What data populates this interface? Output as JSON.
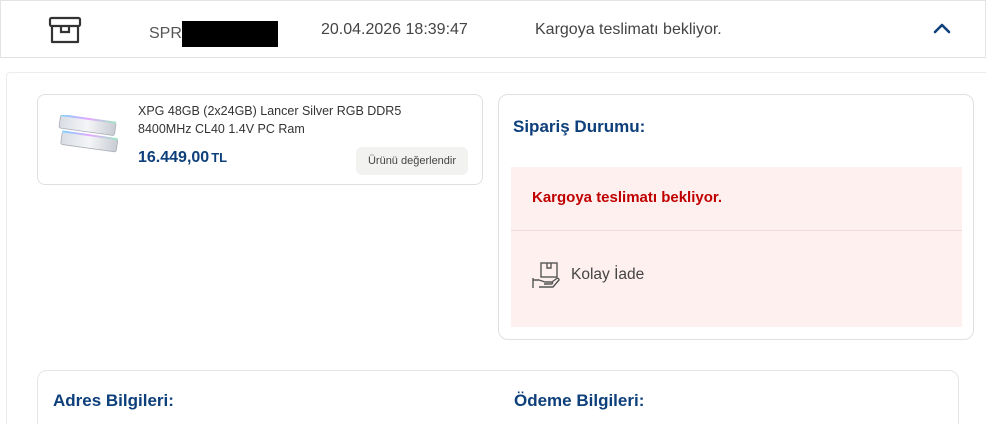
{
  "order": {
    "number_prefix": "SPR",
    "date": "20.04.2026 18:39:47",
    "status": "Kargoya teslimatı bekliyor.",
    "icon": "package-box-icon",
    "collapse_icon": "chevron-up-icon"
  },
  "product": {
    "name": "XPG 48GB (2x24GB) Lancer Silver RGB DDR5 8400MHz CL40 1.4V PC Ram",
    "price": "16.449,00",
    "currency": "TL",
    "rate_button": "Ürünü değerlendir",
    "image": "ram-module-image"
  },
  "status_card": {
    "title": "Sipariş Durumu:",
    "message": "Kargoya teslimatı bekliyor.",
    "return_label": "Kolay İade",
    "return_icon": "box-hand-return-icon"
  },
  "info": {
    "address_title": "Adres Bilgileri:",
    "payment_title": "Ödeme Bilgileri:"
  },
  "colors": {
    "brand_blue": "#0d3f7a",
    "alert_red": "#c00000",
    "status_bg": "#fdf0ef"
  }
}
